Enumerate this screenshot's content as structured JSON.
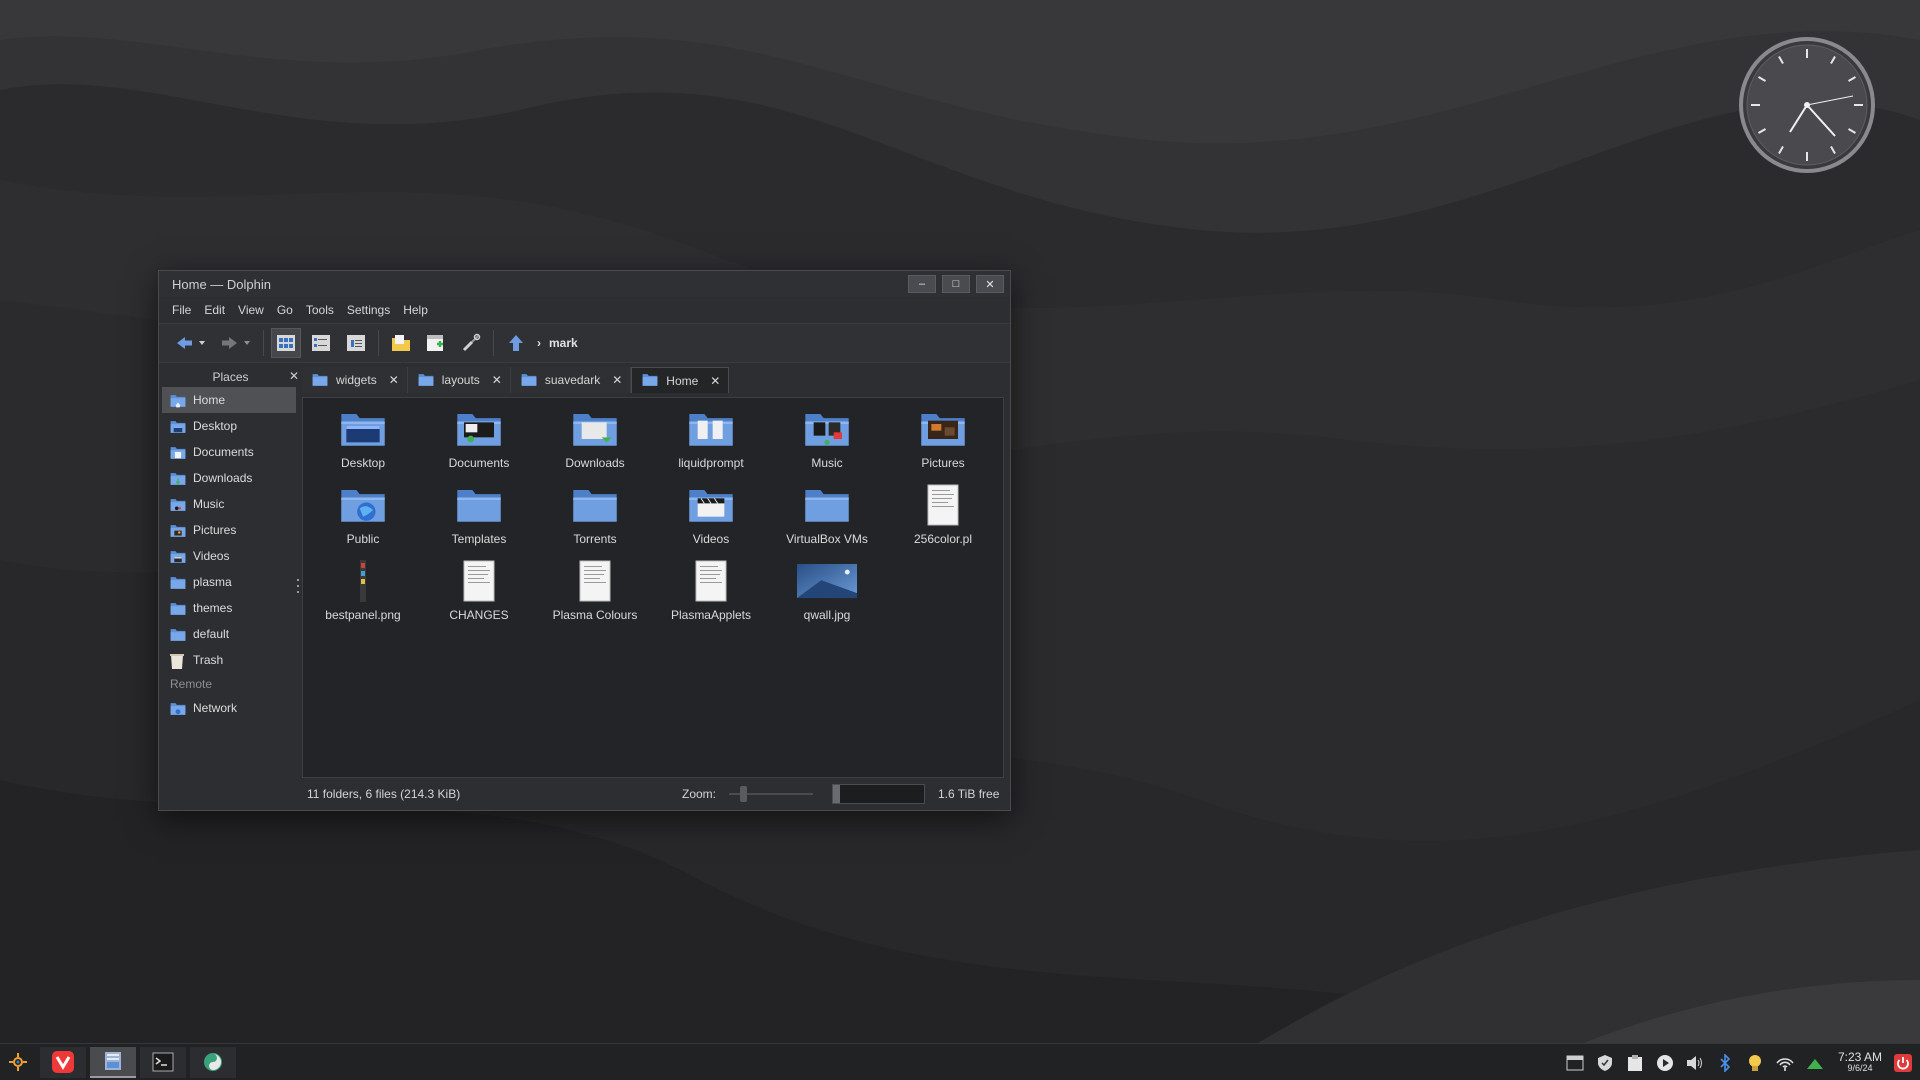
{
  "window": {
    "title": "Home — Dolphin",
    "buttons": {
      "minimize": "–",
      "maximize": "□",
      "close": "✕"
    }
  },
  "menubar": [
    "File",
    "Edit",
    "View",
    "Go",
    "Tools",
    "Settings",
    "Help"
  ],
  "toolbar": {
    "breadcrumb_arrow": "›",
    "breadcrumb": "mark"
  },
  "places": {
    "title": "Places",
    "close": "✕",
    "items": [
      {
        "label": "Home",
        "icon": "home-folder-icon"
      },
      {
        "label": "Desktop",
        "icon": "desktop-folder-icon"
      },
      {
        "label": "Documents",
        "icon": "documents-folder-icon"
      },
      {
        "label": "Downloads",
        "icon": "downloads-folder-icon"
      },
      {
        "label": "Music",
        "icon": "music-folder-icon"
      },
      {
        "label": "Pictures",
        "icon": "pictures-folder-icon"
      },
      {
        "label": "Videos",
        "icon": "videos-folder-icon"
      },
      {
        "label": "plasma",
        "icon": "folder-icon"
      },
      {
        "label": "themes",
        "icon": "folder-icon"
      },
      {
        "label": "default",
        "icon": "folder-icon"
      },
      {
        "label": "Trash",
        "icon": "trash-icon"
      }
    ],
    "remote_label": "Remote",
    "remote_items": [
      {
        "label": "Network",
        "icon": "network-folder-icon"
      }
    ]
  },
  "tabs": [
    {
      "label": "widgets",
      "close": "✕"
    },
    {
      "label": "layouts",
      "close": "✕"
    },
    {
      "label": "suavedark",
      "close": "✕"
    },
    {
      "label": "Home",
      "close": "✕"
    }
  ],
  "files": [
    {
      "name": "Desktop",
      "type": "folder"
    },
    {
      "name": "Documents",
      "type": "folder"
    },
    {
      "name": "Downloads",
      "type": "folder"
    },
    {
      "name": "liquidprompt",
      "type": "folder"
    },
    {
      "name": "Music",
      "type": "folder"
    },
    {
      "name": "Pictures",
      "type": "folder"
    },
    {
      "name": "Public",
      "type": "folder"
    },
    {
      "name": "Templates",
      "type": "folder"
    },
    {
      "name": "Torrents",
      "type": "folder"
    },
    {
      "name": "Videos",
      "type": "folder"
    },
    {
      "name": "VirtualBox VMs",
      "type": "folder"
    },
    {
      "name": "256color.pl",
      "type": "text"
    },
    {
      "name": "bestpanel.png",
      "type": "image-thin"
    },
    {
      "name": "CHANGES",
      "type": "text"
    },
    {
      "name": "Plasma Colours",
      "type": "text"
    },
    {
      "name": "PlasmaApplets",
      "type": "text"
    },
    {
      "name": "qwall.jpg",
      "type": "image"
    }
  ],
  "statusbar": {
    "summary": "11 folders, 6 files (214.3 KiB)",
    "zoom_label": "Zoom:",
    "free": "1.6 TiB free"
  },
  "taskbar": {
    "time": "7:23 AM",
    "date": "9/6/24"
  },
  "colors": {
    "folder_blue": "#5b8fd6",
    "selection": "#505154",
    "view_bg": "#232427"
  }
}
